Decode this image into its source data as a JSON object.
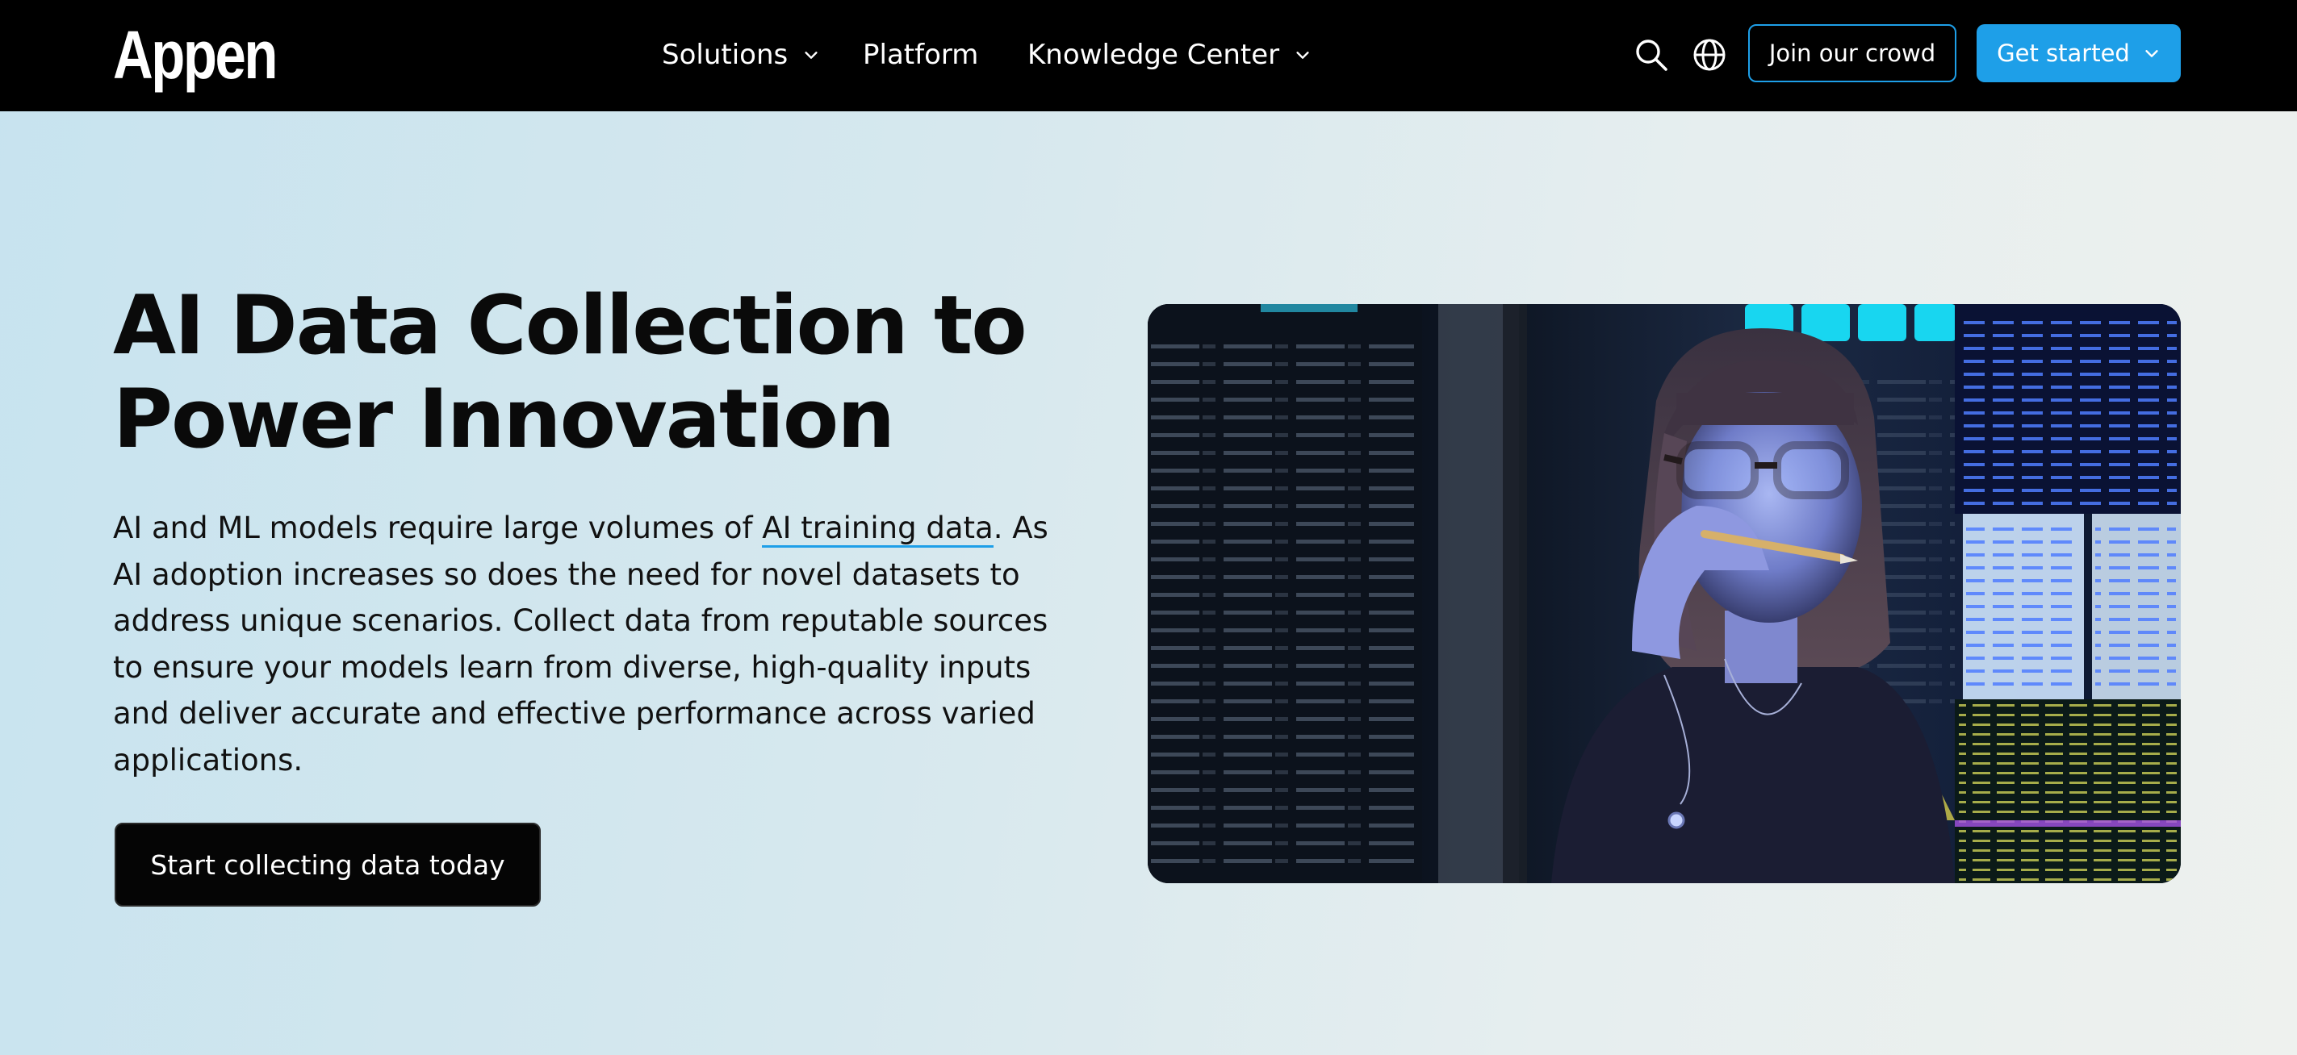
{
  "nav": {
    "logo": "Appen",
    "links": [
      {
        "label": "Solutions",
        "has_dropdown": true
      },
      {
        "label": "Platform",
        "has_dropdown": false
      },
      {
        "label": "Knowledge Center",
        "has_dropdown": true
      }
    ],
    "icons": [
      "search-icon",
      "globe-icon"
    ],
    "join_label": "Join our crowd",
    "get_started_label": "Get started"
  },
  "hero": {
    "title_line1": "AI Data Collection to",
    "title_line2": "Power Innovation",
    "body_before_link": "AI and ML models require large volumes of ",
    "body_link": "AI training data",
    "body_after_link": ". As AI adoption increases so does the need for novel datasets to address unique scenarios. Collect data from reputable sources to ensure your models learn from diverse, high-quality inputs and deliver accurate and effective performance across varied applications.",
    "cta_label": "Start collecting data today"
  },
  "colors": {
    "accent": "#1e9fe8",
    "nav_background": "#000000",
    "cta_background": "#050505"
  }
}
